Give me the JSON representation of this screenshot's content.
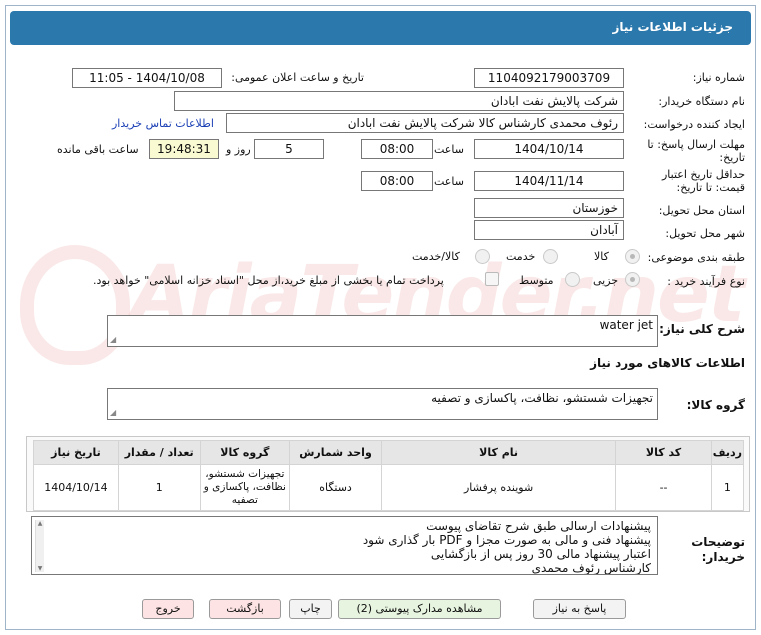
{
  "header": {
    "title": "جزئیات اطلاعات نیاز"
  },
  "watermark": {
    "text": "AriaTender.net"
  },
  "labels": {
    "need_number": "شماره نیاز:",
    "announce_datetime": "تاریخ و ساعت اعلان عمومی:",
    "buyer_org": "نام دستگاه خریدار:",
    "requester": "ایجاد کننده درخواست:",
    "buyer_contact": "اطلاعات تماس خریدار",
    "reply_deadline_line1": "مهلت ارسال پاسخ: تا",
    "reply_deadline_line2": "تاریخ:",
    "time_word": "ساعت",
    "day_and": "روز و",
    "remaining": "ساعت باقی مانده",
    "price_validity_line1": "حداقل تاریخ اعتبار",
    "price_validity_line2": "قیمت: تا تاریخ:",
    "delivery_province": "استان محل تحویل:",
    "delivery_city": "شهر محل تحویل:",
    "category": "طبقه بندی موضوعی:",
    "purchase_type": "نوع فرآیند خرید :",
    "need_summary": "شرح کلی نیاز:",
    "goods_info": "اطلاعات کالاهای مورد نیاز",
    "goods_group": "گروه کالا:",
    "buyer_notes_line1": "توضیحات",
    "buyer_notes_line2": "خریدار:"
  },
  "fields": {
    "need_number": "1104092179003709",
    "announce_datetime": "1404/10/08 - 11:05",
    "buyer_org": "شرکت پالایش نفت ابادان",
    "requester": "رئوف محمدی کارشناس کالا شرکت پالایش نفت ابادان",
    "reply_date": "1404/10/14",
    "reply_time": "08:00",
    "reply_days": "5",
    "reply_remaining": "19:48:31",
    "validity_date": "1404/11/14",
    "validity_time": "08:00",
    "province": "خوزستان",
    "city": "آبادان",
    "need_summary": "water jet",
    "goods_group": "تجهیزات شستشو، نظافت، پاکسازی و تصفیه"
  },
  "category_options": [
    {
      "label": "کالا",
      "selected": true
    },
    {
      "label": "خدمت",
      "selected": false
    },
    {
      "label": "کالا/خدمت",
      "selected": false
    }
  ],
  "purchase_options": [
    {
      "label": "جزیی",
      "selected": true
    },
    {
      "label": "متوسط",
      "selected": false
    }
  ],
  "purchase_note": "پرداخت تمام یا بخشی از مبلغ خرید،از محل \"اسناد خزانه اسلامی\" خواهد بود.",
  "table": {
    "headers": [
      "ردیف",
      "کد کالا",
      "نام کالا",
      "واحد شمارش",
      "گروه کالا",
      "تعداد / مقدار",
      "تاریخ نیاز"
    ],
    "rows": [
      [
        "1",
        "--",
        "شوینده پرفشار",
        "دستگاه",
        "تجهیزات شستشو، نظافت، پاکسازی و تصفیه",
        "1",
        "1404/10/14"
      ]
    ]
  },
  "buyer_notes": [
    "پیشنهادات ارسالی طبق شرح تقاضای پیوست",
    "پیشنهاد فنی و مالی به صورت مجزا و PDF بار گذاری شود",
    "اعتبار پیشنهاد مالی 30 روز پس از بازگشایی",
    "کارشناس رئوف  محمدی"
  ],
  "buttons": {
    "reply": "پاسخ به نیاز",
    "docs": "مشاهده مدارک پیوستی (2)",
    "print": "چاپ",
    "back": "بازگشت",
    "exit": "خروج"
  }
}
